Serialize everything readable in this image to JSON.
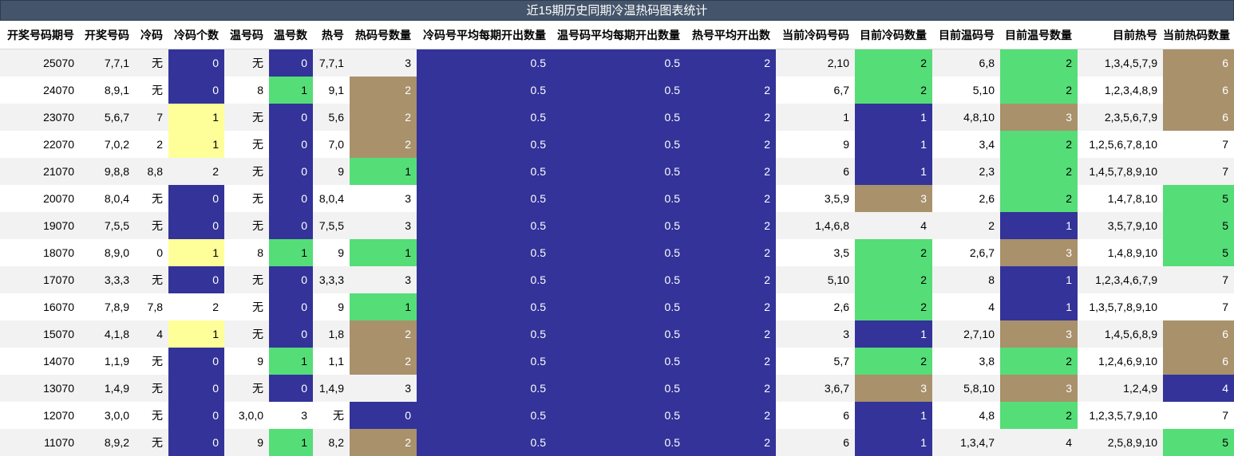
{
  "title": "近15期历史同期冷温热码图表统计",
  "headers": [
    "开奖号码期号",
    "开奖号码",
    "冷码",
    "冷码个数",
    "温号码",
    "温号数",
    "热号",
    "热码号数量",
    "冷码号平均每期开出数量",
    "温号码平均每期开出数量",
    "热号平均开出数",
    "当前冷码号码",
    "目前冷码数量",
    "目前温码号",
    "目前温号数量",
    "目前热号",
    "当前热码数量"
  ],
  "colors": {
    "blue": "#333399",
    "green": "#55dd77",
    "tan": "#a8916b",
    "yellow": "#ffff99",
    "title_bg": "#44546a"
  },
  "rows": [
    [
      "25070",
      "7,7,1",
      "无",
      "0",
      "无",
      "0",
      "7,7,1",
      "3",
      "0.5",
      "0.5",
      "2",
      "2,10",
      "2",
      "6,8",
      "2",
      "1,3,4,5,7,9",
      "6"
    ],
    [
      "24070",
      "8,9,1",
      "无",
      "0",
      "8",
      "1",
      "9,1",
      "2",
      "0.5",
      "0.5",
      "2",
      "6,7",
      "2",
      "5,10",
      "2",
      "1,2,3,4,8,9",
      "6"
    ],
    [
      "23070",
      "5,6,7",
      "7",
      "1",
      "无",
      "0",
      "5,6",
      "2",
      "0.5",
      "0.5",
      "2",
      "1",
      "1",
      "4,8,10",
      "3",
      "2,3,5,6,7,9",
      "6"
    ],
    [
      "22070",
      "7,0,2",
      "2",
      "1",
      "无",
      "0",
      "7,0",
      "2",
      "0.5",
      "0.5",
      "2",
      "9",
      "1",
      "3,4",
      "2",
      "1,2,5,6,7,8,10",
      "7"
    ],
    [
      "21070",
      "9,8,8",
      "8,8",
      "2",
      "无",
      "0",
      "9",
      "1",
      "0.5",
      "0.5",
      "2",
      "6",
      "1",
      "2,3",
      "2",
      "1,4,5,7,8,9,10",
      "7"
    ],
    [
      "20070",
      "8,0,4",
      "无",
      "0",
      "无",
      "0",
      "8,0,4",
      "3",
      "0.5",
      "0.5",
      "2",
      "3,5,9",
      "3",
      "2,6",
      "2",
      "1,4,7,8,10",
      "5"
    ],
    [
      "19070",
      "7,5,5",
      "无",
      "0",
      "无",
      "0",
      "7,5,5",
      "3",
      "0.5",
      "0.5",
      "2",
      "1,4,6,8",
      "4",
      "2",
      "1",
      "3,5,7,9,10",
      "5"
    ],
    [
      "18070",
      "8,9,0",
      "0",
      "1",
      "8",
      "1",
      "9",
      "1",
      "0.5",
      "0.5",
      "2",
      "3,5",
      "2",
      "2,6,7",
      "3",
      "1,4,8,9,10",
      "5"
    ],
    [
      "17070",
      "3,3,3",
      "无",
      "0",
      "无",
      "0",
      "3,3,3",
      "3",
      "0.5",
      "0.5",
      "2",
      "5,10",
      "2",
      "8",
      "1",
      "1,2,3,4,6,7,9",
      "7"
    ],
    [
      "16070",
      "7,8,9",
      "7,8",
      "2",
      "无",
      "0",
      "9",
      "1",
      "0.5",
      "0.5",
      "2",
      "2,6",
      "2",
      "4",
      "1",
      "1,3,5,7,8,9,10",
      "7"
    ],
    [
      "15070",
      "4,1,8",
      "4",
      "1",
      "无",
      "0",
      "1,8",
      "2",
      "0.5",
      "0.5",
      "2",
      "3",
      "1",
      "2,7,10",
      "3",
      "1,4,5,6,8,9",
      "6"
    ],
    [
      "14070",
      "1,1,9",
      "无",
      "0",
      "9",
      "1",
      "1,1",
      "2",
      "0.5",
      "0.5",
      "2",
      "5,7",
      "2",
      "3,8",
      "2",
      "1,2,4,6,9,10",
      "6"
    ],
    [
      "13070",
      "1,4,9",
      "无",
      "0",
      "无",
      "0",
      "1,4,9",
      "3",
      "0.5",
      "0.5",
      "2",
      "3,6,7",
      "3",
      "5,8,10",
      "3",
      "1,2,4,9",
      "4"
    ],
    [
      "12070",
      "3,0,0",
      "无",
      "0",
      "3,0,0",
      "3",
      "无",
      "0",
      "0.5",
      "0.5",
      "2",
      "6",
      "1",
      "4,8",
      "2",
      "1,2,3,5,7,9,10",
      "7"
    ],
    [
      "11070",
      "8,9,2",
      "无",
      "0",
      "9",
      "1",
      "8,2",
      "2",
      "0.5",
      "0.5",
      "2",
      "6",
      "1",
      "1,3,4,7",
      "4",
      "2,5,8,9,10",
      "5"
    ]
  ],
  "cell_colors": [
    {
      "c3": "blue",
      "c5": "blue",
      "c7": "",
      "c12": "green",
      "c14": "green",
      "c16": "tan"
    },
    {
      "c3": "blue",
      "c5": "green",
      "c7": "tan",
      "c12": "green",
      "c14": "green",
      "c16": "tan"
    },
    {
      "c3": "yellow",
      "c5": "blue",
      "c7": "tan",
      "c12": "blue",
      "c14": "tan",
      "c16": "tan"
    },
    {
      "c3": "yellow",
      "c5": "blue",
      "c7": "tan",
      "c12": "blue",
      "c14": "green",
      "c16": ""
    },
    {
      "c3": "",
      "c5": "blue",
      "c7": "green",
      "c12": "blue",
      "c14": "green",
      "c16": ""
    },
    {
      "c3": "blue",
      "c5": "blue",
      "c7": "",
      "c12": "tan",
      "c14": "green",
      "c16": "green"
    },
    {
      "c3": "blue",
      "c5": "blue",
      "c7": "",
      "c12": "",
      "c14": "blue",
      "c16": "green"
    },
    {
      "c3": "yellow",
      "c5": "green",
      "c7": "green",
      "c12": "green",
      "c14": "tan",
      "c16": "green"
    },
    {
      "c3": "blue",
      "c5": "blue",
      "c7": "",
      "c12": "green",
      "c14": "blue",
      "c16": ""
    },
    {
      "c3": "",
      "c5": "blue",
      "c7": "green",
      "c12": "green",
      "c14": "blue",
      "c16": ""
    },
    {
      "c3": "yellow",
      "c5": "blue",
      "c7": "tan",
      "c12": "blue",
      "c14": "tan",
      "c16": "tan"
    },
    {
      "c3": "blue",
      "c5": "green",
      "c7": "tan",
      "c12": "green",
      "c14": "green",
      "c16": "tan"
    },
    {
      "c3": "blue",
      "c5": "blue",
      "c7": "",
      "c12": "tan",
      "c14": "tan",
      "c16": "blue"
    },
    {
      "c3": "blue",
      "c5": "",
      "c7": "blue",
      "c12": "blue",
      "c14": "green",
      "c16": ""
    },
    {
      "c3": "blue",
      "c5": "green",
      "c7": "tan",
      "c12": "blue",
      "c14": "",
      "c16": "green"
    }
  ]
}
